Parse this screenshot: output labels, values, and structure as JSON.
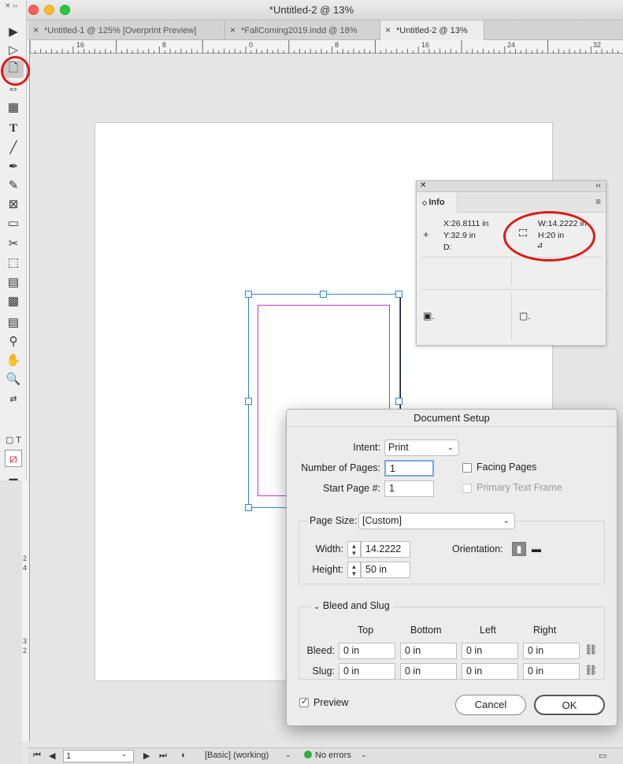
{
  "window": {
    "title": "*Untitled-2 @ 13%"
  },
  "tabs": [
    {
      "label": "*Untitled-1 @ 125% [Overprint Preview]",
      "active": false
    },
    {
      "label": "*FallComing2019.indd @ 18%",
      "active": false
    },
    {
      "label": "*Untitled-2 @ 13%",
      "active": true
    }
  ],
  "ruler": {
    "labels": [
      "16",
      "8",
      "0",
      "8",
      "16",
      "24",
      "32"
    ]
  },
  "vruler": {
    "labels": [
      "2",
      "4",
      "3",
      "2"
    ]
  },
  "tools": [
    "selection-tool",
    "direct-selection-tool",
    "page-tool",
    "gap-tool",
    "content-collector-tool",
    "type-tool",
    "line-tool",
    "pen-tool",
    "pencil-tool",
    "rectangle-frame-tool",
    "rectangle-tool",
    "scissors-tool",
    "free-transform-tool",
    "gradient-swatch-tool",
    "gradient-feather-tool",
    "note-tool",
    "eyedropper-tool",
    "hand-tool",
    "zoom-tool"
  ],
  "info_panel": {
    "tab": "Info",
    "x": "X:26.8111 in",
    "y": "Y:32.9 in",
    "d": "D:",
    "w": "W:14.2222 in",
    "h": "H:20 in"
  },
  "dialog": {
    "title": "Document Setup",
    "intent_label": "Intent:",
    "intent_value": "Print",
    "pages_label": "Number of Pages:",
    "pages_value": "1",
    "start_label": "Start Page #:",
    "start_value": "1",
    "facing_label": "Facing Pages",
    "primary_label": "Primary Text Frame",
    "pagesize_label": "Page Size:",
    "pagesize_value": "[Custom]",
    "width_label": "Width:",
    "width_value": "14.2222",
    "height_label": "Height:",
    "height_value": "50 in",
    "orientation_label": "Orientation:",
    "bleed_section": "Bleed and Slug",
    "col_top": "Top",
    "col_bottom": "Bottom",
    "col_left": "Left",
    "col_right": "Right",
    "bleed_label": "Bleed:",
    "slug_label": "Slug:",
    "bleed_values": [
      "0 in",
      "0 in",
      "0 in",
      "0 in"
    ],
    "slug_values": [
      "0 in",
      "0 in",
      "0 in",
      "0 in"
    ],
    "preview_label": "Preview",
    "cancel_label": "Cancel",
    "ok_label": "OK"
  },
  "status": {
    "page": "1",
    "style": "[Basic] (working)",
    "errors": "No errors"
  },
  "colors": {
    "selection": "#2f86d2",
    "margin": "#cc33cc",
    "annotation": "#e01818",
    "ok_status": "#2fae44"
  }
}
